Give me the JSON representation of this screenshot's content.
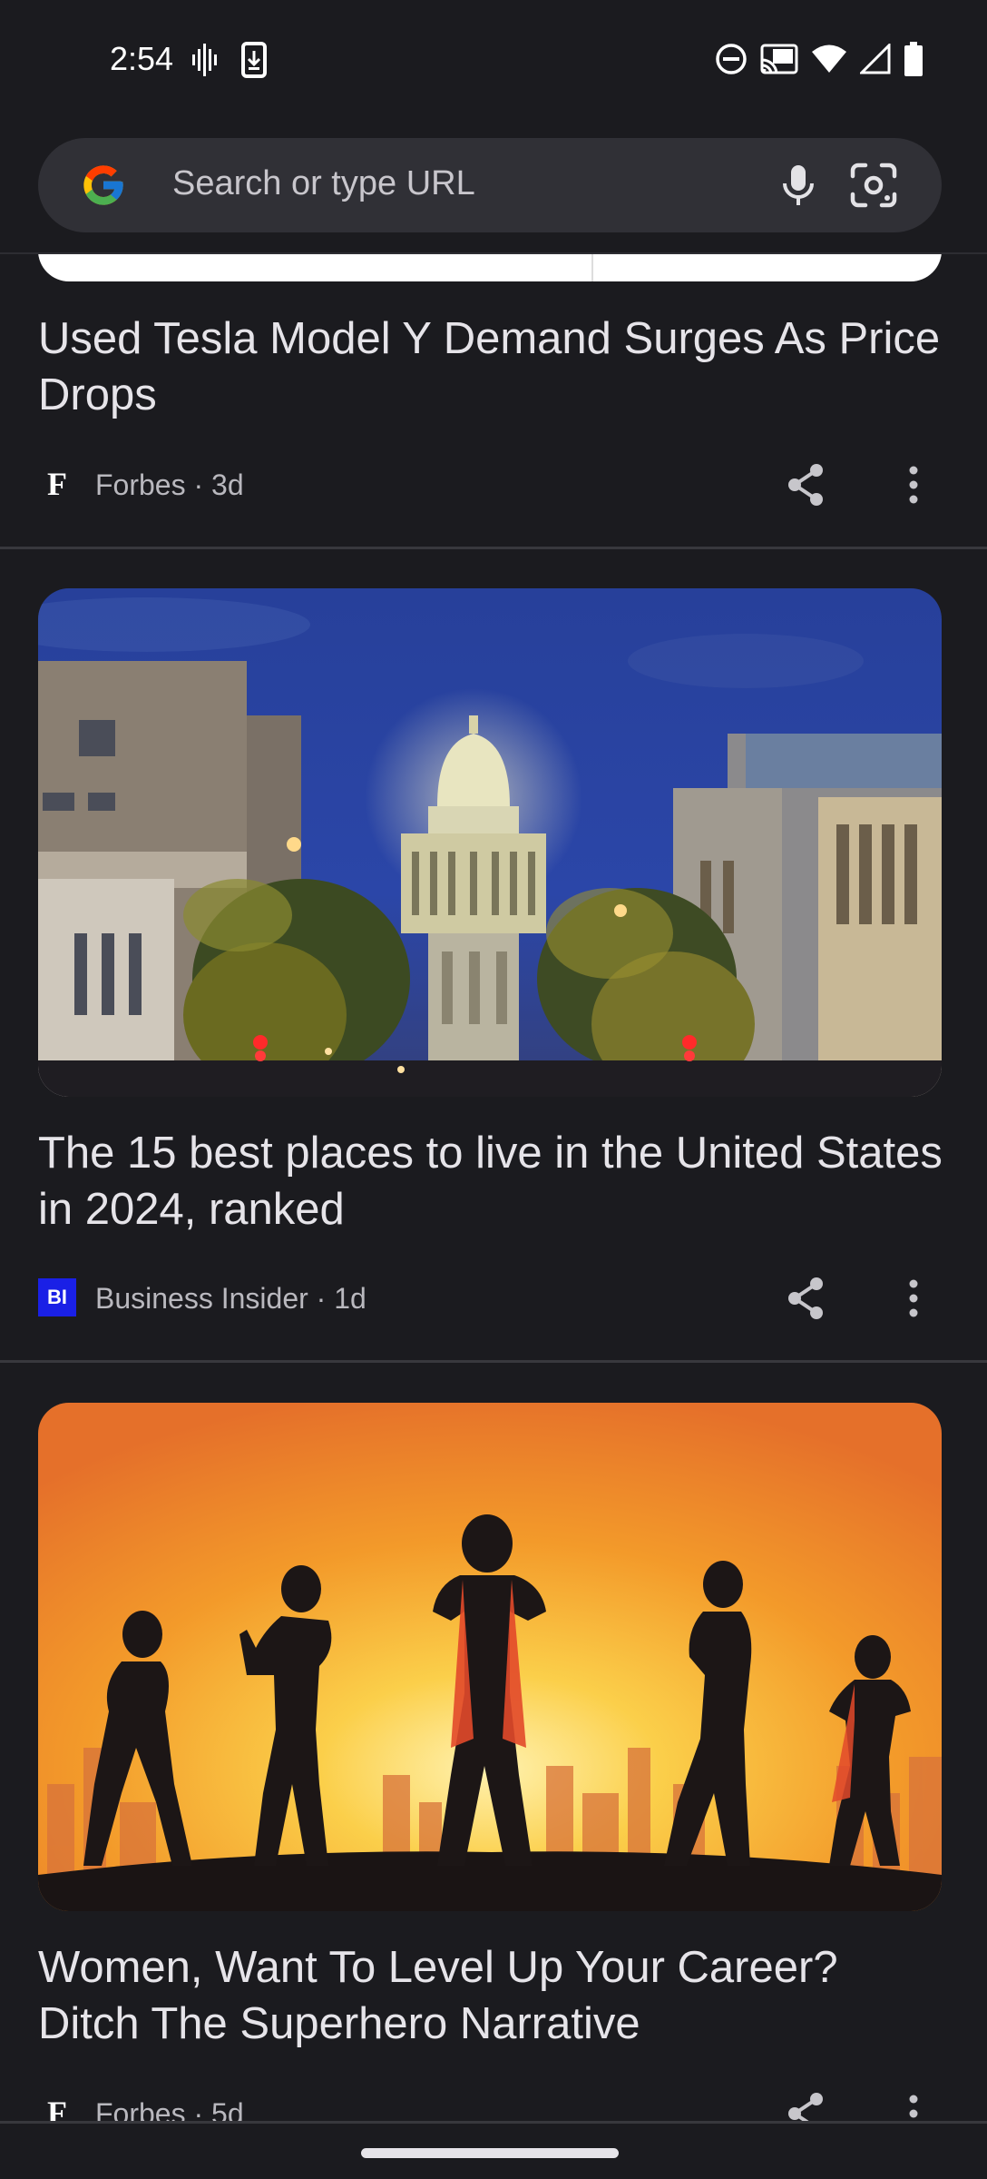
{
  "status_bar": {
    "time": "2:54",
    "left_icons": [
      "voice-activity-icon",
      "download-icon"
    ],
    "right_icons": [
      "do-not-disturb-icon",
      "cast-icon",
      "wifi-icon",
      "signal-icon",
      "battery-icon"
    ]
  },
  "search": {
    "placeholder": "Search or type URL",
    "icons": [
      "google-logo",
      "mic-icon",
      "lens-icon"
    ]
  },
  "feed": {
    "articles": [
      {
        "title": "Used Tesla Model Y Demand Surges As Price Drops",
        "source": "Forbes",
        "age": "3d",
        "meta": "Forbes · 3d",
        "source_logo": "F"
      },
      {
        "title": "The 15 best places to live in the United States in 2024, ranked",
        "source": "Business Insider",
        "age": "1d",
        "meta": "Business Insider · 1d",
        "source_logo": "BI",
        "image": "capitol-dome-street-night"
      },
      {
        "title": "Women, Want To Level Up Your Career? Ditch The Superhero Narrative",
        "source": "Forbes",
        "age": "5d",
        "meta": "Forbes · 5d",
        "source_logo": "F",
        "image": "superhero-women-silhouettes-sunset"
      }
    ]
  },
  "colors": {
    "background": "#1b1b1f",
    "search_bar": "#303036",
    "divider": "#38383d",
    "bi_blue": "#1a20e6"
  }
}
